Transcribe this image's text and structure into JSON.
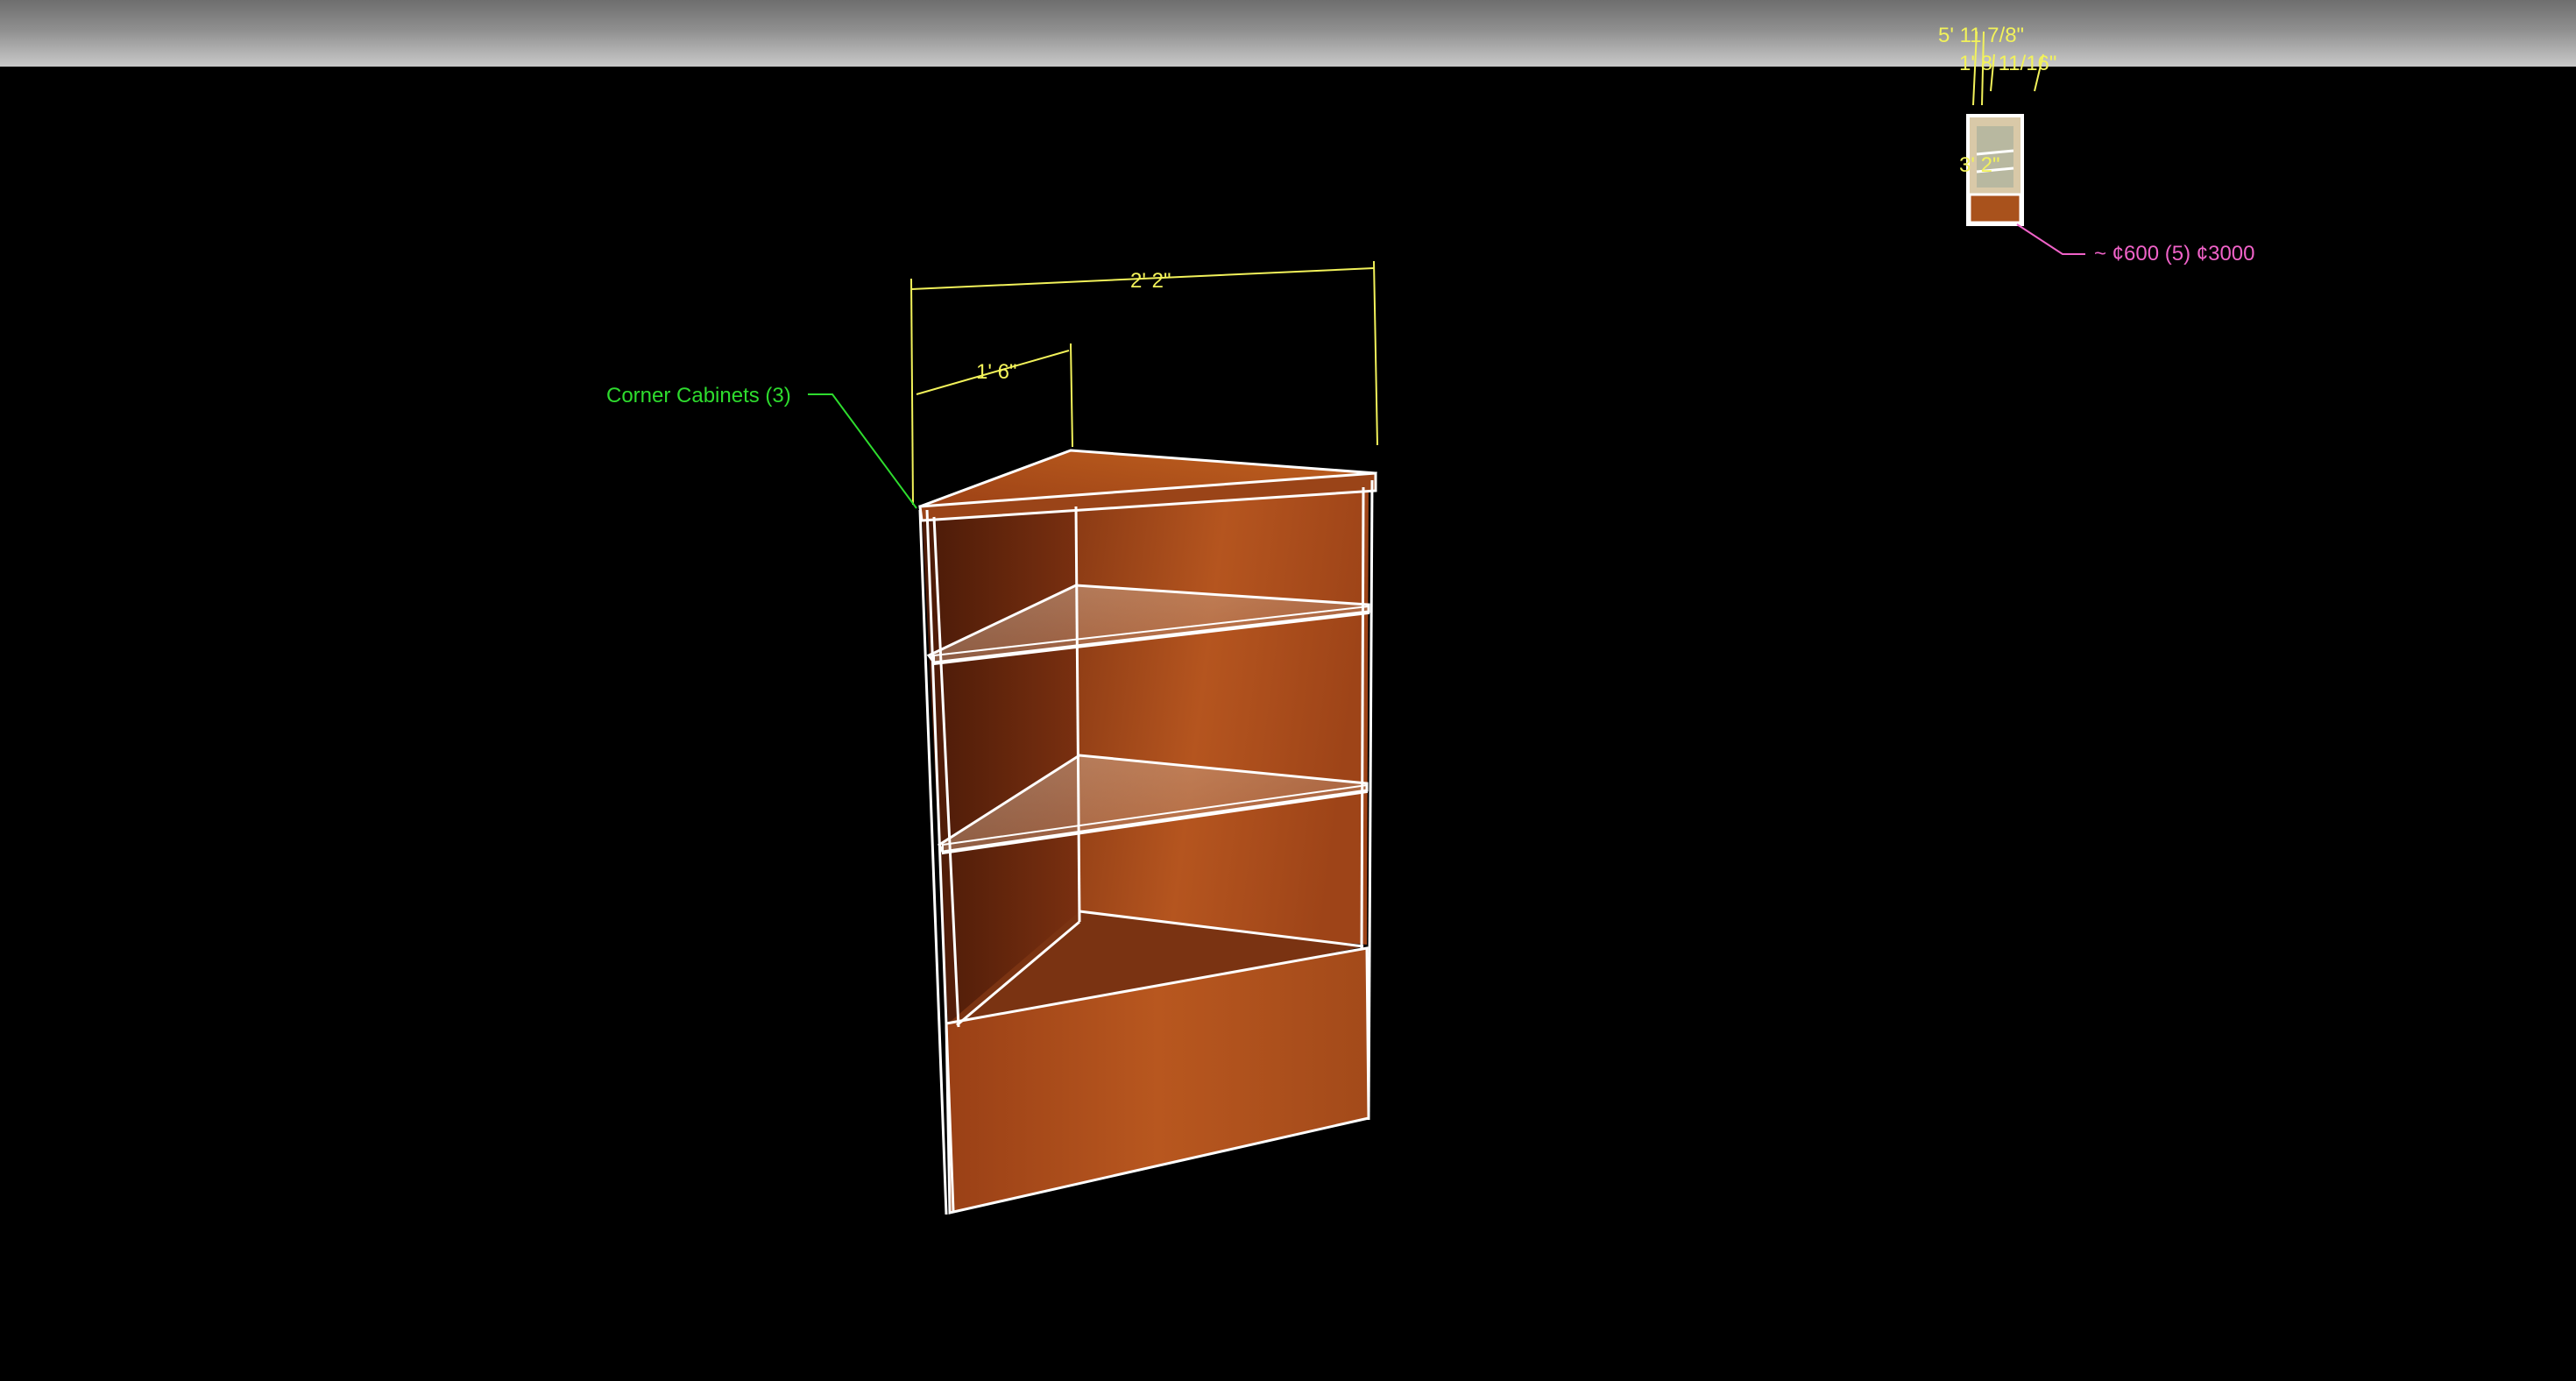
{
  "colors": {
    "background": "#000000",
    "dimension": "#f2f25a",
    "label_green": "#2edc2e",
    "label_pink": "#f062c8",
    "wood_light": "#b0521f",
    "wood_dark": "#5e2410",
    "outline": "#ffffff"
  },
  "model": {
    "name_label": "Corner  Cabinets (3)",
    "dim_width": "2' 2\"",
    "dim_depth": "1' 6\""
  },
  "thumbnail": {
    "dim_height": "5' 11 7/8\"",
    "dim_width": "1' 8 11/16\"",
    "dim_side": "3' 2\"",
    "price_label": "~ ¢600 (5) ¢3000"
  }
}
